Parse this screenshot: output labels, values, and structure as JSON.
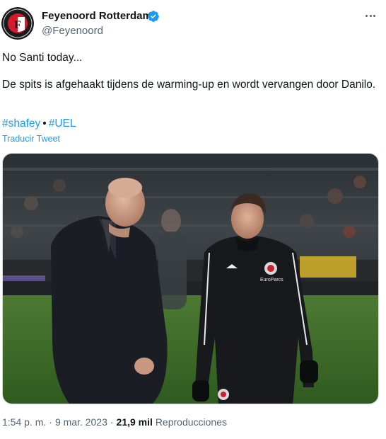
{
  "author": {
    "name": "Feyenoord Rotterdam",
    "handle": "@Feyenoord",
    "verified": true,
    "avatar_icon": "feyenoord-crest-icon",
    "avatar_letter": "F"
  },
  "tweet": {
    "line1": "No Santi today...",
    "line2": "De spits is afgehaakt tijdens de warming-up en wordt vervangen door Danilo.",
    "hashtags": [
      "#shafey",
      "#UEL"
    ],
    "hashtag_separator": "•",
    "translate_label": "Traducir Tweet",
    "photo_sponsor": "EuroParcs"
  },
  "footer": {
    "time": "1:54 p. m.",
    "date": "9 mar. 2023",
    "views_count": "21,9 mil",
    "views_label": "Reproducciones",
    "separator": "·"
  },
  "colors": {
    "link": "#1d9bf0",
    "text": "#0f1419",
    "muted": "#536471",
    "verified": "#1d9bf0"
  }
}
